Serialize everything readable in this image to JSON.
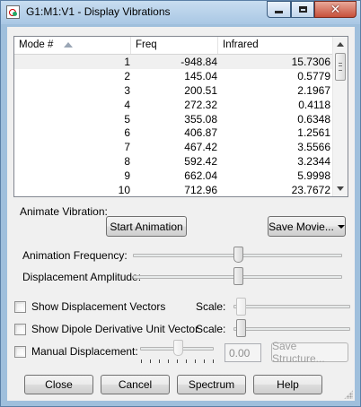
{
  "window": {
    "title": "G1:M1:V1 - Display Vibrations"
  },
  "table": {
    "columns": [
      "Mode #",
      "Freq",
      "Infrared"
    ],
    "rows": [
      [
        "1",
        "-948.84",
        "15.7306"
      ],
      [
        "2",
        "145.04",
        "0.5779"
      ],
      [
        "3",
        "200.51",
        "2.1967"
      ],
      [
        "4",
        "272.32",
        "0.4118"
      ],
      [
        "5",
        "355.08",
        "0.6348"
      ],
      [
        "6",
        "406.87",
        "1.2561"
      ],
      [
        "7",
        "467.42",
        "3.5566"
      ],
      [
        "8",
        "592.42",
        "3.2344"
      ],
      [
        "9",
        "662.04",
        "5.9998"
      ],
      [
        "10",
        "712.96",
        "23.7672"
      ]
    ]
  },
  "animate": {
    "label": "Animate Vibration:",
    "start_button": "Start Animation",
    "save_movie_button": "Save Movie..."
  },
  "sliders": {
    "frequency_label": "Animation Frequency:",
    "amplitude_label": "Displacement Amplitude:",
    "frequency_value": 0.5,
    "amplitude_value": 0.5
  },
  "options": {
    "show_displacement_vectors": "Show Displacement Vectors",
    "show_dipole_vector": "Show Dipole Derivative Unit Vector",
    "manual_displacement": "Manual Displacement:",
    "scale_label": "Scale:",
    "manual_value": "0.00",
    "save_structure_button": "Save Structure..."
  },
  "footer": {
    "close": "Close",
    "cancel": "Cancel",
    "spectrum": "Spectrum",
    "help": "Help"
  },
  "colors": {
    "titlebar": "#a9c7e4",
    "close_button": "#c7503a",
    "panel": "#f0f0f0"
  }
}
